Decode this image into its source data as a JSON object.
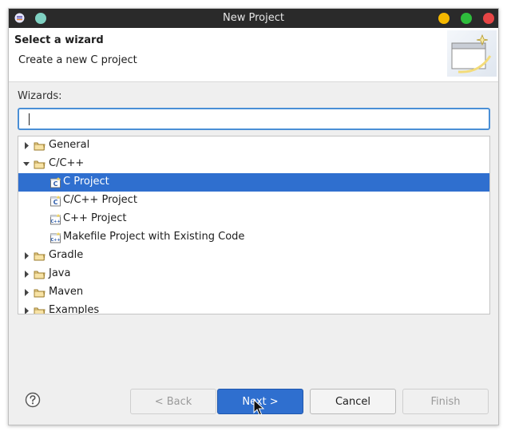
{
  "window": {
    "title": "New Project"
  },
  "header": {
    "title": "Select a wizard",
    "description": "Create a new C project"
  },
  "wizards": {
    "label": "Wizards:",
    "search_value": ""
  },
  "tree": [
    {
      "label": "General",
      "level": 0,
      "kind": "folder",
      "expanded": false,
      "selected": false
    },
    {
      "label": "C/C++",
      "level": 0,
      "kind": "folder",
      "expanded": true,
      "selected": false
    },
    {
      "label": "C Project",
      "level": 1,
      "kind": "c-project",
      "selected": true
    },
    {
      "label": "C/C++ Project",
      "level": 1,
      "kind": "c-project",
      "selected": false
    },
    {
      "label": "C++ Project",
      "level": 1,
      "kind": "cpp-project",
      "selected": false
    },
    {
      "label": "Makefile Project with Existing Code",
      "level": 1,
      "kind": "cpp-project",
      "selected": false
    },
    {
      "label": "Gradle",
      "level": 0,
      "kind": "folder",
      "expanded": false,
      "selected": false
    },
    {
      "label": "Java",
      "level": 0,
      "kind": "folder",
      "expanded": false,
      "selected": false
    },
    {
      "label": "Maven",
      "level": 0,
      "kind": "folder",
      "expanded": false,
      "selected": false
    },
    {
      "label": "Examples",
      "level": 0,
      "kind": "folder",
      "expanded": false,
      "selected": false
    }
  ],
  "buttons": {
    "back": "< Back",
    "next": "Next >",
    "cancel": "Cancel",
    "finish": "Finish"
  },
  "colors": {
    "selection": "#2f6fcf",
    "minimize": "#f5b800",
    "maximize": "#2ebd3c",
    "close": "#e64545",
    "extra": "#7fd1c2"
  }
}
